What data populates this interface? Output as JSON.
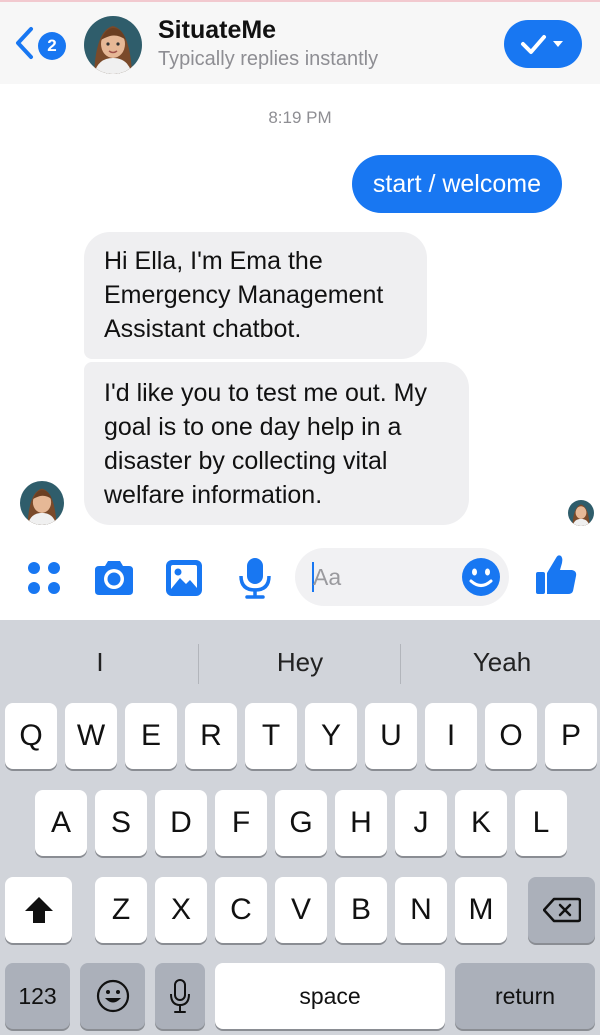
{
  "header": {
    "unread_count": "2",
    "title": "SituateMe",
    "subtitle": "Typically replies instantly"
  },
  "conversation": {
    "timestamp": "8:19 PM",
    "outgoing": [
      "start / welcome"
    ],
    "incoming": [
      "Hi Ella, I'm Ema the Emergency Management Assistant chatbot.",
      "I'd like you to test me out. My goal is to one day help in a disaster by collecting vital welfare information."
    ]
  },
  "composer": {
    "placeholder": "Aa",
    "icons": [
      "apps-icon",
      "camera-icon",
      "photo-icon",
      "microphone-icon",
      "emoji-icon",
      "thumbs-up-icon"
    ]
  },
  "keyboard": {
    "suggestions": [
      "I",
      "Hey",
      "Yeah"
    ],
    "row1": [
      "Q",
      "W",
      "E",
      "R",
      "T",
      "Y",
      "U",
      "I",
      "O",
      "P"
    ],
    "row2": [
      "A",
      "S",
      "D",
      "F",
      "G",
      "H",
      "J",
      "K",
      "L"
    ],
    "row3": [
      "Z",
      "X",
      "C",
      "V",
      "B",
      "N",
      "M"
    ],
    "numbers_label": "123",
    "space_label": "space",
    "return_label": "return"
  },
  "colors": {
    "accent": "#1877f2",
    "incoming_bubble": "#efeff1",
    "keyboard_bg": "#d1d4da"
  }
}
